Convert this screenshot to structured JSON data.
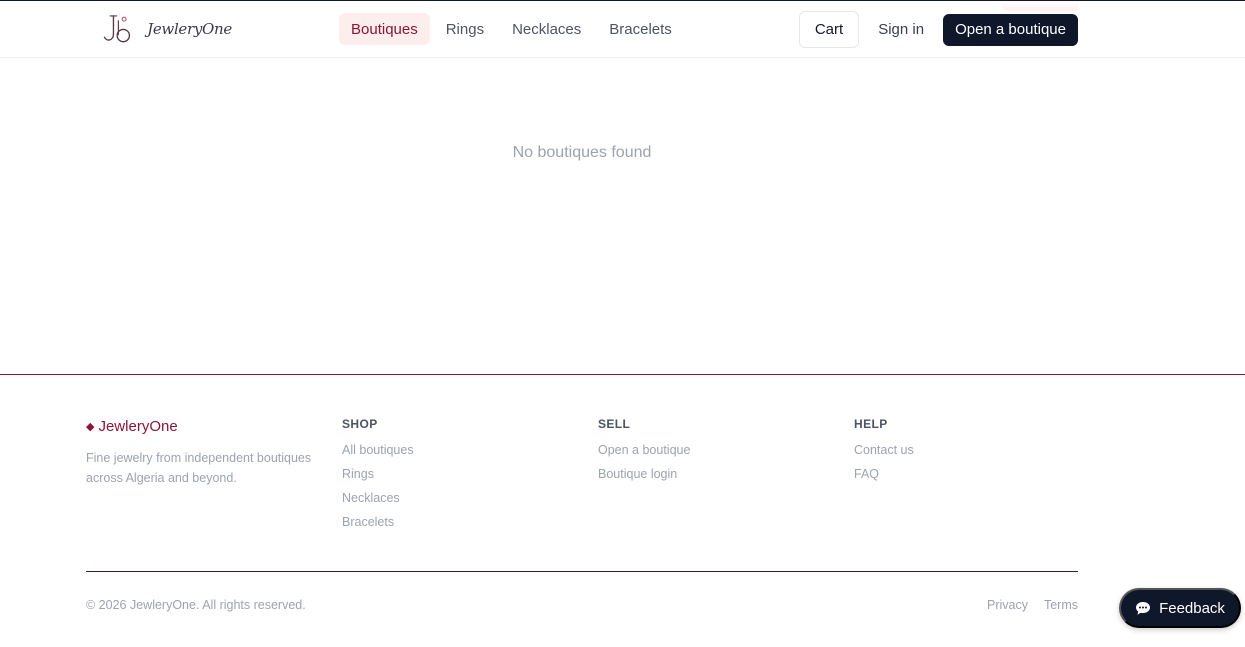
{
  "header": {
    "logo_text": "JewleryOne",
    "nav": [
      {
        "label": "Boutiques",
        "active": true
      },
      {
        "label": "Rings",
        "active": false
      },
      {
        "label": "Necklaces",
        "active": false
      },
      {
        "label": "Bracelets",
        "active": false
      }
    ],
    "cart_label": "Cart",
    "signin_label": "Sign in",
    "open_boutique_label": "Open a boutique"
  },
  "main": {
    "empty_message": "No boutiques found"
  },
  "footer": {
    "brand": "JewleryOne",
    "brand_icon": "diamond-icon",
    "tagline": "Fine jewelry from independent boutiques across Algeria and beyond.",
    "columns": [
      {
        "title": "SHOP",
        "links": [
          "All boutiques",
          "Rings",
          "Necklaces",
          "Bracelets"
        ]
      },
      {
        "title": "SELL",
        "links": [
          "Open a boutique",
          "Boutique login"
        ]
      },
      {
        "title": "HELP",
        "links": [
          "Contact us",
          "FAQ"
        ]
      }
    ],
    "copyright": "© 2026 JewleryOne. All rights reserved.",
    "legal": [
      "Privacy",
      "Terms"
    ]
  },
  "feedback": {
    "label": "Feedback",
    "icon": "chat-bubble-icon"
  },
  "colors": {
    "brand": "#8b1538",
    "dark": "#0f172a",
    "muted": "#9ca3af",
    "active_bg": "#fdeeee"
  }
}
